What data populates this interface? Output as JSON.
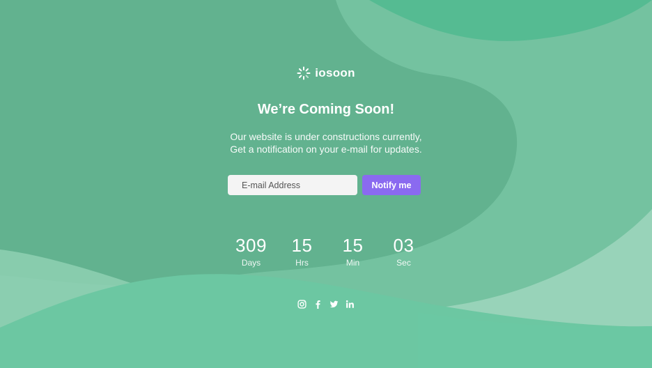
{
  "brand": {
    "name": "iosoon",
    "logo_icon": "loading-spinner-icon"
  },
  "hero": {
    "headline": "We’re Coming Soon!",
    "subtext_line1": "Our website is under constructions currently,",
    "subtext_line2": "Get a notification on your e-mail for updates."
  },
  "signup": {
    "email_placeholder": "E-mail Address",
    "email_value": "",
    "button_label": "Notify me"
  },
  "countdown": [
    {
      "value": "309",
      "label": "Days"
    },
    {
      "value": "15",
      "label": "Hrs"
    },
    {
      "value": "15",
      "label": "Min"
    },
    {
      "value": "03",
      "label": "Sec"
    }
  ],
  "social": [
    {
      "icon": "instagram-icon"
    },
    {
      "icon": "facebook-icon"
    },
    {
      "icon": "twitter-icon"
    },
    {
      "icon": "linkedin-icon"
    }
  ],
  "colors": {
    "background": "#62b28f",
    "accent_button": "#8a6af0",
    "text": "#ffffff",
    "input_background": "#f4f4f4"
  }
}
